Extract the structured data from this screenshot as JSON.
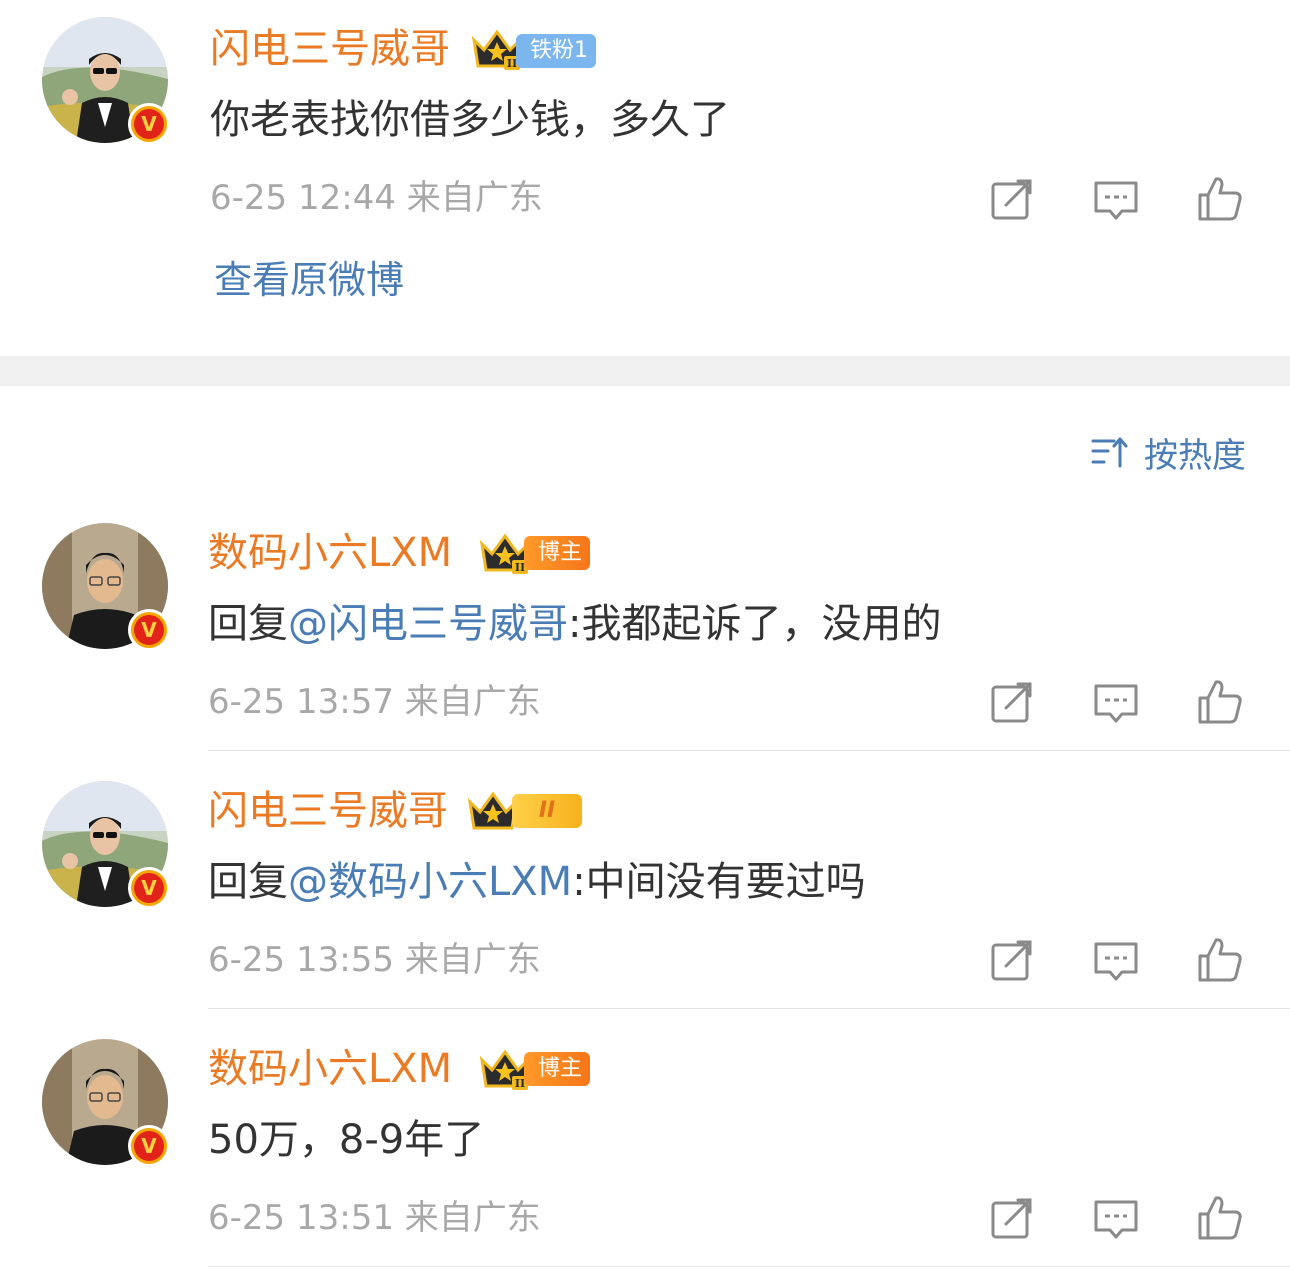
{
  "top_comment": {
    "username": "闪电三号威哥",
    "tag": "铁粉1",
    "text": "你老表找你借多少钱，多久了",
    "meta": "6-25 12:44  来自广东",
    "view_original": "查看原微博"
  },
  "sort": {
    "label": "按热度"
  },
  "replies": [
    {
      "username": "数码小六LXM",
      "tag": "博主",
      "reply_prefix": "回复",
      "mention": "@闪电三号威哥",
      "text": ":我都起诉了，没用的",
      "meta": "6-25 13:57  来自广东"
    },
    {
      "username": "闪电三号威哥",
      "tag": "II",
      "reply_prefix": "回复",
      "mention": "@数码小六LXM",
      "text": ":中间没有要过吗",
      "meta": "6-25 13:55  来自广东"
    },
    {
      "username": "数码小六LXM",
      "tag": "博主",
      "text": "50万，8-9年了",
      "meta": "6-25 13:51  来自广东"
    }
  ],
  "icons": {
    "share": "share-icon",
    "comment": "comment-icon",
    "like": "thumbs-up-icon",
    "crown": "crown-icon",
    "verified": "verified-v-icon",
    "sort": "sort-icon"
  },
  "colors": {
    "username": "#ea7a24",
    "link": "#4a7cb5",
    "meta": "#a8a8a8",
    "text": "#333333",
    "separator": "#f0f0f0"
  }
}
